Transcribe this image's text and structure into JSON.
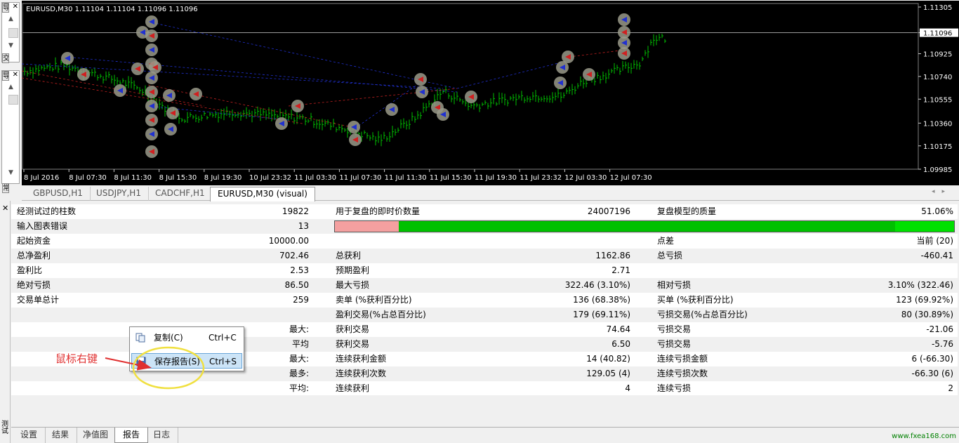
{
  "side": {
    "top_label": "导",
    "mid_label": "交",
    "bottom_label": "常",
    "terminal_label": "测试"
  },
  "chart": {
    "title": "EURUSD,M30  1.11104 1.11104 1.11096 1.11096",
    "price_labels": [
      "1.11305",
      "1.11096",
      "1.10925",
      "1.10740",
      "1.10555",
      "1.10360",
      "1.10175",
      "1.09985"
    ],
    "time_labels": [
      "8 Jul 2016",
      "8 Jul 07:30",
      "8 Jul 11:30",
      "8 Jul 15:30",
      "8 Jul 19:30",
      "10 Jul 23:32",
      "11 Jul 03:30",
      "11 Jul 07:30",
      "11 Jul 11:30",
      "11 Jul 15:30",
      "11 Jul 19:30",
      "11 Jul 23:32",
      "12 Jul 03:30",
      "12 Jul 07:30"
    ],
    "colors": {
      "background": "#000000",
      "candles": "#00c000",
      "current_price": "#ffffff"
    }
  },
  "chart_tabs": [
    "GBPUSD,H1",
    "USDJPY,H1",
    "CADCHF,H1",
    "EURUSD,M30 (visual)"
  ],
  "report": {
    "rows": [
      {
        "c1": "经测试过的柱数",
        "v1": "19822",
        "c2": "用于复盘的即时价数量",
        "v2": "24007196",
        "c3": "复盘模型的质量",
        "v3": "51.06%"
      },
      {
        "c1": "输入图表错误",
        "v1": "13",
        "c2": "",
        "v2": "",
        "c3": "",
        "v3": ""
      },
      {
        "c1": "起始资金",
        "v1": "10000.00",
        "c2": "",
        "v2": "",
        "c3": "点差",
        "v3": "当前 (20)"
      },
      {
        "c1": "总净盈利",
        "v1": "702.46",
        "c2": "总获利",
        "v2": "1162.86",
        "c3": "总亏损",
        "v3": "-460.41"
      },
      {
        "c1": "盈利比",
        "v1": "2.53",
        "c2": "预期盈利",
        "v2": "2.71",
        "c3": "",
        "v3": ""
      },
      {
        "c1": "绝对亏损",
        "v1": "86.50",
        "c2": "最大亏损",
        "v2": "322.46 (3.10%)",
        "c3": "相对亏损",
        "v3": "3.10% (322.46)"
      },
      {
        "c1": "交易单总计",
        "v1": "259",
        "c2": "卖单 (%获利百分比)",
        "v2": "136 (68.38%)",
        "c3": "买单 (%获利百分比)",
        "v3": "123 (69.92%)"
      },
      {
        "c1": "",
        "v1": "",
        "c2": "盈利交易(%占总百分比)",
        "v2": "179 (69.11%)",
        "c3": "亏损交易(%占总百分比)",
        "v3": "80 (30.89%)"
      },
      {
        "c1": "",
        "v1": "最大:",
        "c2": "获利交易",
        "v2": "74.64",
        "c3": "亏损交易",
        "v3": "-21.06"
      },
      {
        "c1": "",
        "v1": "平均",
        "c2": "获利交易",
        "v2": "6.50",
        "c3": "亏损交易",
        "v3": "-5.76"
      },
      {
        "c1": "",
        "v1": "最大:",
        "c2": "连续获利金额",
        "v2": "14 (40.82)",
        "c3": "连续亏损金额",
        "v3": "6 (-66.30)"
      },
      {
        "c1": "",
        "v1": "最多:",
        "c2": "连续获利次数",
        "v2": "129.05 (4)",
        "c3": "连续亏损次数",
        "v3": "-66.30 (6)"
      },
      {
        "c1": "",
        "v1": "平均:",
        "c2": "连续获利",
        "v2": "4",
        "c3": "连续亏损",
        "v3": "2"
      }
    ],
    "quality_bar": {
      "red_fraction": 0.103,
      "bright_fraction": 0.095
    }
  },
  "context_menu": {
    "items": [
      {
        "label": "复制(C)",
        "shortcut": "Ctrl+C",
        "icon": "copy-icon"
      },
      {
        "label": "保存报告(S)",
        "shortcut": "Ctrl+S",
        "icon": "save-icon"
      }
    ]
  },
  "annotation": {
    "text": "鼠标右键",
    "color": "#e03030"
  },
  "bottom_tabs": [
    "设置",
    "结果",
    "净值图",
    "报告",
    "日志"
  ],
  "active_bottom_tab": "报告",
  "watermark": "www.fxea168.com"
}
